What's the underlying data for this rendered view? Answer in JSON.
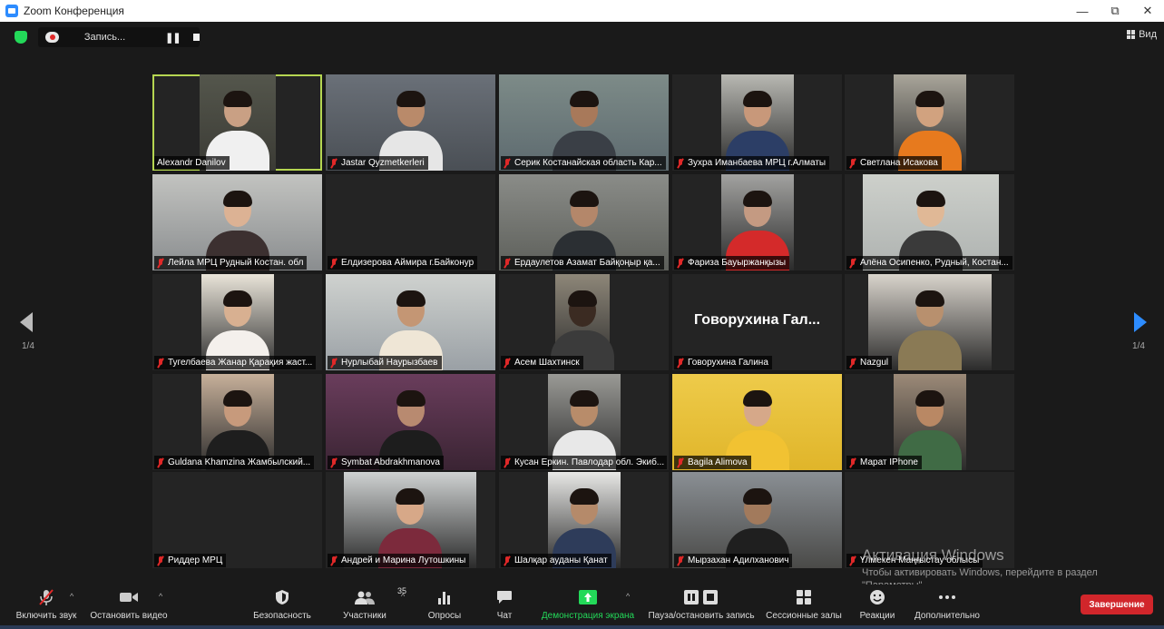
{
  "window": {
    "title": "Zoom Конференция",
    "controls": [
      "—",
      "⧉",
      "✕"
    ]
  },
  "topbar": {
    "recording_label": "Запись...",
    "pause_glyph": "❚❚",
    "view_label": "Вид"
  },
  "pagination": {
    "left": "1/4",
    "right": "1/4"
  },
  "participants": [
    {
      "name": "Alexandr Danilov",
      "muted": false,
      "active": true
    },
    {
      "name": "Jastar Qyzmetkerleri",
      "muted": true
    },
    {
      "name": "Серик Костанайская область Кар...",
      "muted": true
    },
    {
      "name": "Зухра Иманбаева МРЦ г.Алматы",
      "muted": true
    },
    {
      "name": "Светлана Исакова",
      "muted": true
    },
    {
      "name": "Лейла МРЦ Рудный Костан. обл",
      "muted": true
    },
    {
      "name": "Елдизерова Аймира г.Байконур",
      "muted": true
    },
    {
      "name": "Ердаулетов Азамат Байқоңыр қа...",
      "muted": true
    },
    {
      "name": "Фариза Бауыржанқызы",
      "muted": true
    },
    {
      "name": "Алёна Осипенко, Рудный, Костан...",
      "muted": true
    },
    {
      "name": "Тугелбаева Жанар Қарақия жаст...",
      "muted": true
    },
    {
      "name": "Нурлыбай Наурызбаев",
      "muted": true
    },
    {
      "name": "Асем Шахтинск",
      "muted": true
    },
    {
      "name": "Говорухина Галина",
      "muted": true,
      "big_label": "Говорухина Гал..."
    },
    {
      "name": "Nazgul",
      "muted": true
    },
    {
      "name": "Guldana Khamzina Жамбылский...",
      "muted": true
    },
    {
      "name": "Symbat Abdrakhmanova",
      "muted": true
    },
    {
      "name": "Кусан Еркин. Павлодар обл. Экиб...",
      "muted": true
    },
    {
      "name": "Bagila Alimova",
      "muted": true
    },
    {
      "name": "Марат IPhone",
      "muted": true
    },
    {
      "name": "Риддер МРЦ",
      "muted": true
    },
    {
      "name": "Андрей и Марина Лутошкины",
      "muted": true
    },
    {
      "name": "Шалқар ауданы Қанат",
      "muted": true
    },
    {
      "name": "Мырзахан Адилханович",
      "muted": true
    },
    {
      "name": "Үлмекен Маңғыстау облысы",
      "muted": true
    }
  ],
  "toolbar": {
    "unmute": "Включить звук",
    "stop_video": "Остановить видео",
    "security": "Безопасность",
    "participants": "Участники",
    "participants_count": "35",
    "polls": "Опросы",
    "chat": "Чат",
    "share_screen": "Демонстрация экрана",
    "pause_recording": "Пауза/остановить запись",
    "breakout_rooms": "Сессионные залы",
    "reactions": "Реакции",
    "more": "Дополнительно",
    "end": "Завершение"
  },
  "watermark": {
    "title": "Активация Windows",
    "line1": "Чтобы активировать Windows, перейдите в раздел",
    "line2": "\"Параметры\"."
  },
  "colors": {
    "accent_green": "#23d959",
    "active_border": "#b5d651",
    "end_red": "#d1262b",
    "zoom_blue": "#2d8cff"
  }
}
